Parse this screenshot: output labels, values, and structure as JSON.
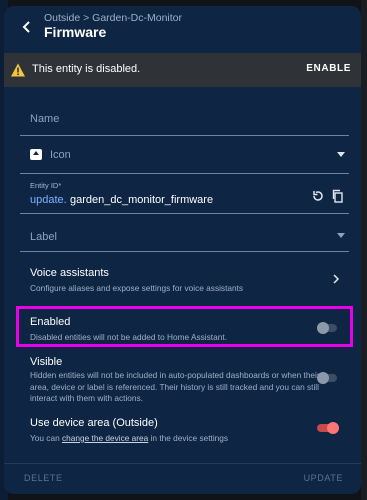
{
  "header": {
    "breadcrumb": "Outside > Garden-Dc-Monitor",
    "title": "Firmware"
  },
  "banner": {
    "message": "This entity is disabled.",
    "action": "ENABLE",
    "icon": "warning-icon"
  },
  "fields": {
    "name": {
      "label": "Name",
      "value": ""
    },
    "icon": {
      "label": "Icon",
      "icon": "upload-icon"
    },
    "entity_id": {
      "label": "Entity ID*",
      "prefix": "update.",
      "value": "garden_dc_monitor_firmware"
    },
    "label": {
      "label": "Label"
    }
  },
  "voice": {
    "title": "Voice assistants",
    "subtitle": "Configure aliases and expose settings for voice assistants"
  },
  "enabled": {
    "title": "Enabled",
    "subtitle": "Disabled entities will not be added to Home Assistant.",
    "on": false
  },
  "visible": {
    "title": "Visible",
    "subtitle": "Hidden entities will not be included in auto-populated dashboards or when their area, device or label is referenced. Their history is still tracked and you can still interact with them with actions.",
    "on": false
  },
  "device_area": {
    "title": "Use device area (Outside)",
    "subtitle_prefix": "You can ",
    "subtitle_link": "change the device area",
    "subtitle_suffix": " in the device settings",
    "on": true
  },
  "footer": {
    "delete": "DELETE",
    "update": "UPDATE"
  },
  "colors": {
    "dialog_bg": "#0e2644",
    "highlight": "#e800e8",
    "toggle_on": "#ff7474",
    "accent_link": "#7fb1ff"
  }
}
